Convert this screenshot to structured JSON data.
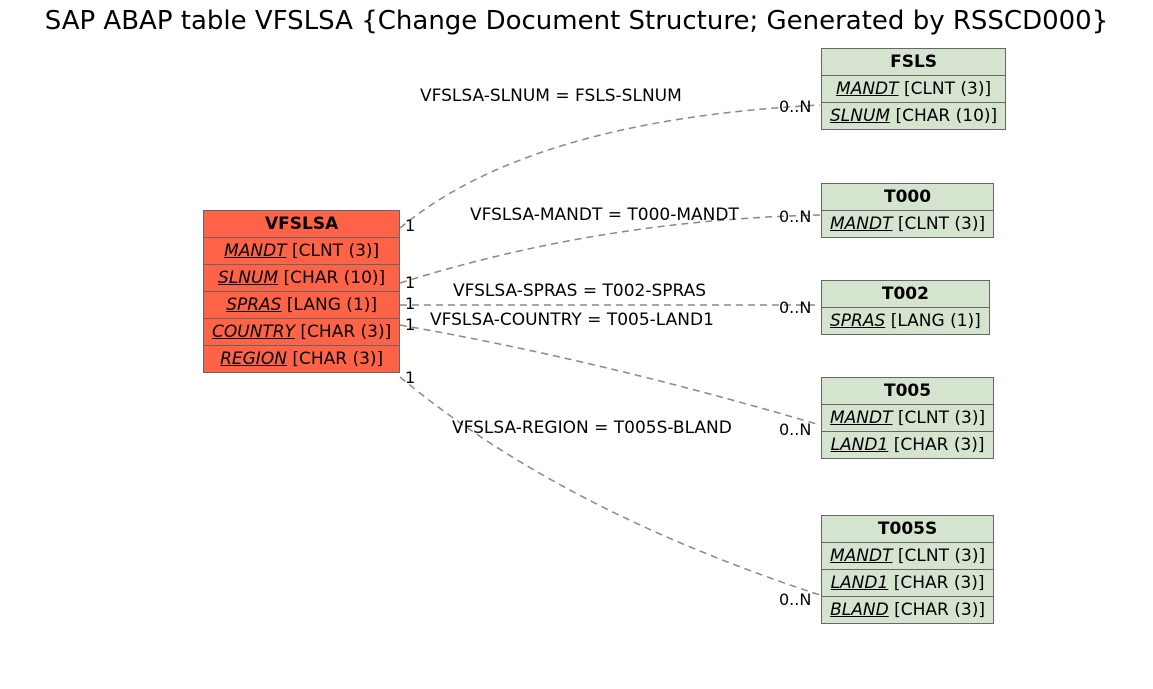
{
  "title": "SAP ABAP table VFSLSA {Change Document Structure; Generated by RSSCD000}",
  "main_table": {
    "name": "VFSLSA",
    "fields": [
      {
        "name": "MANDT",
        "type": "[CLNT (3)]"
      },
      {
        "name": "SLNUM",
        "type": "[CHAR (10)]"
      },
      {
        "name": "SPRAS",
        "type": "[LANG (1)]"
      },
      {
        "name": "COUNTRY",
        "type": "[CHAR (3)]"
      },
      {
        "name": "REGION",
        "type": "[CHAR (3)]"
      }
    ]
  },
  "ref_tables": [
    {
      "name": "FSLS",
      "fields": [
        {
          "name": "MANDT",
          "type": "[CLNT (3)]"
        },
        {
          "name": "SLNUM",
          "type": "[CHAR (10)]"
        }
      ]
    },
    {
      "name": "T000",
      "fields": [
        {
          "name": "MANDT",
          "type": "[CLNT (3)]"
        }
      ]
    },
    {
      "name": "T002",
      "fields": [
        {
          "name": "SPRAS",
          "type": "[LANG (1)]"
        }
      ]
    },
    {
      "name": "T005",
      "fields": [
        {
          "name": "MANDT",
          "type": "[CLNT (3)]"
        },
        {
          "name": "LAND1",
          "type": "[CHAR (3)]"
        }
      ]
    },
    {
      "name": "T005S",
      "fields": [
        {
          "name": "MANDT",
          "type": "[CLNT (3)]"
        },
        {
          "name": "LAND1",
          "type": "[CHAR (3)]"
        },
        {
          "name": "BLAND",
          "type": "[CHAR (3)]"
        }
      ]
    }
  ],
  "relations": [
    {
      "label": "VFSLSA-SLNUM = FSLS-SLNUM",
      "src_card": "1",
      "dst_card": "0..N"
    },
    {
      "label": "VFSLSA-MANDT = T000-MANDT",
      "src_card": "1",
      "dst_card": "0..N"
    },
    {
      "label": "VFSLSA-SPRAS = T002-SPRAS",
      "src_card": "1",
      "dst_card": "0..N"
    },
    {
      "label": "VFSLSA-COUNTRY = T005-LAND1",
      "src_card": "1",
      "dst_card": "0..N"
    },
    {
      "label": "VFSLSA-REGION = T005S-BLAND",
      "src_card": "1",
      "dst_card": "0..N"
    }
  ]
}
